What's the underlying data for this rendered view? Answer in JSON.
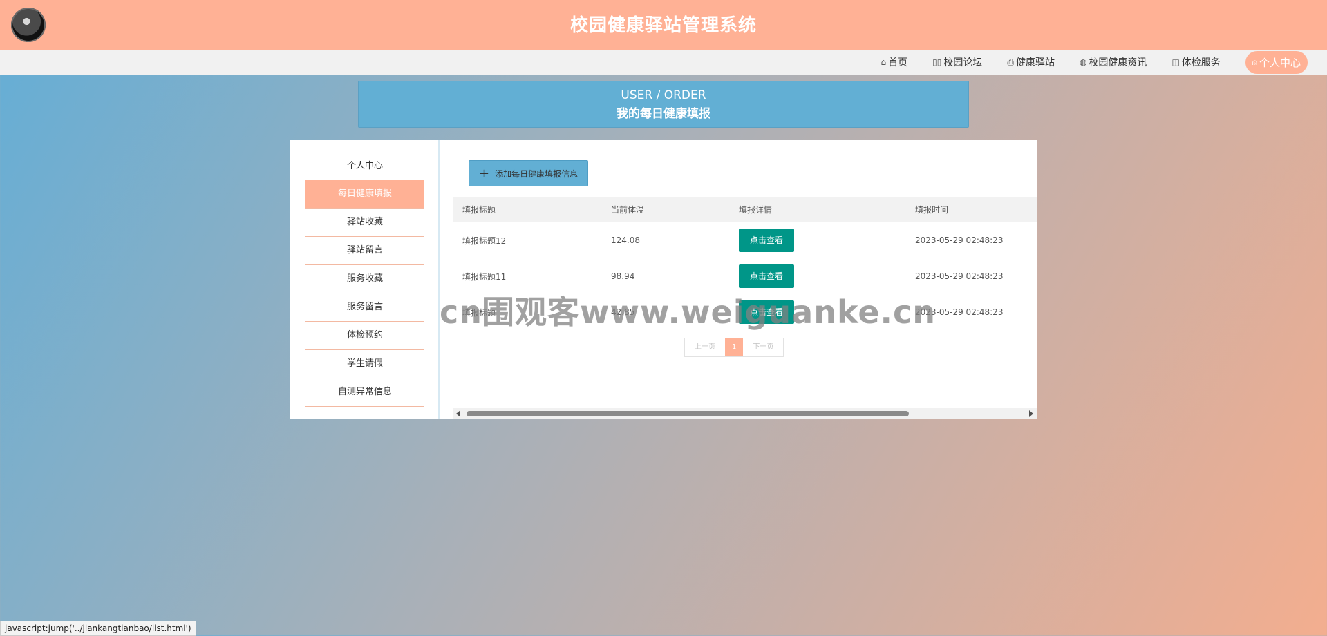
{
  "header": {
    "title": "校园健康驿站管理系统",
    "logo_icon": "logo-icon"
  },
  "nav": {
    "items": [
      {
        "label": "首页",
        "icon": "⌂"
      },
      {
        "label": "校园论坛",
        "icon": "▯▯"
      },
      {
        "label": "健康驿站",
        "icon": "⎙"
      },
      {
        "label": "校园健康资讯",
        "icon": "◍"
      },
      {
        "label": "体检服务",
        "icon": "◫"
      },
      {
        "label": "个人中心",
        "icon": "⍝"
      }
    ]
  },
  "page_head": {
    "en": "USER / ORDER",
    "zh": "我的每日健康填报"
  },
  "sidebar": {
    "items": [
      "个人中心",
      "每日健康填报",
      "驿站收藏",
      "驿站留言",
      "服务收藏",
      "服务留言",
      "体检预约",
      "学生请假",
      "自测异常信息"
    ]
  },
  "toolbar": {
    "add_label": "添加每日健康填报信息"
  },
  "table": {
    "headers": [
      "填报标题",
      "当前体温",
      "填报详情",
      "填报时间"
    ],
    "rows": [
      {
        "title": "填报标题12",
        "temp": "124.08",
        "detail": "点击查看",
        "time": "2023-05-29 02:48:23"
      },
      {
        "title": "填报标题11",
        "temp": "98.94",
        "detail": "点击查看",
        "time": "2023-05-29 02:48:23"
      },
      {
        "title": "填报标题",
        "temp": "42.85",
        "detail": "点击查看",
        "time": "2023-05-29 02:48:23"
      }
    ]
  },
  "pager": {
    "prev": "上一页",
    "current": "1",
    "next": "下一页"
  },
  "watermark": "cn围观客www.weiguanke.cn",
  "status_bar": "javascript:jump('../jiankangtianbao/list.html')",
  "colors": {
    "header_bg": "#ffb195",
    "accent_blue": "#62afd4",
    "button_green": "#009688"
  }
}
